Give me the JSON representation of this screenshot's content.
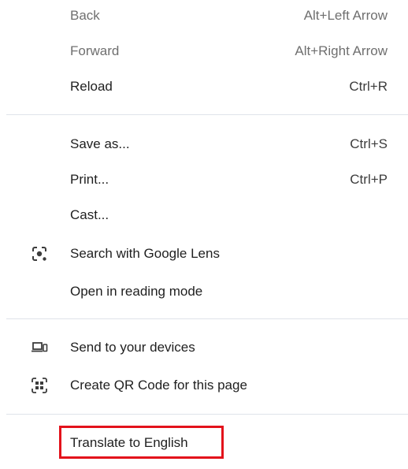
{
  "menu": {
    "group1": [
      {
        "label": "Back",
        "shortcut": "Alt+Left Arrow"
      },
      {
        "label": "Forward",
        "shortcut": "Alt+Right Arrow"
      },
      {
        "label": "Reload",
        "shortcut": "Ctrl+R"
      }
    ],
    "group2": [
      {
        "label": "Save as...",
        "shortcut": "Ctrl+S"
      },
      {
        "label": "Print...",
        "shortcut": "Ctrl+P"
      },
      {
        "label": "Cast..."
      },
      {
        "label": "Search with Google Lens",
        "icon": "google-lens-icon"
      },
      {
        "label": "Open in reading mode"
      }
    ],
    "group3": [
      {
        "label": "Send to your devices",
        "icon": "devices-icon"
      },
      {
        "label": "Create QR Code for this page",
        "icon": "qr-code-icon"
      }
    ],
    "group4": [
      {
        "label": "Translate to English"
      }
    ]
  },
  "colors": {
    "highlight": "#e3121b",
    "separator": "#dfe3ea",
    "text": "#1f1f1f",
    "disabled_text": "#6f6f6f"
  }
}
